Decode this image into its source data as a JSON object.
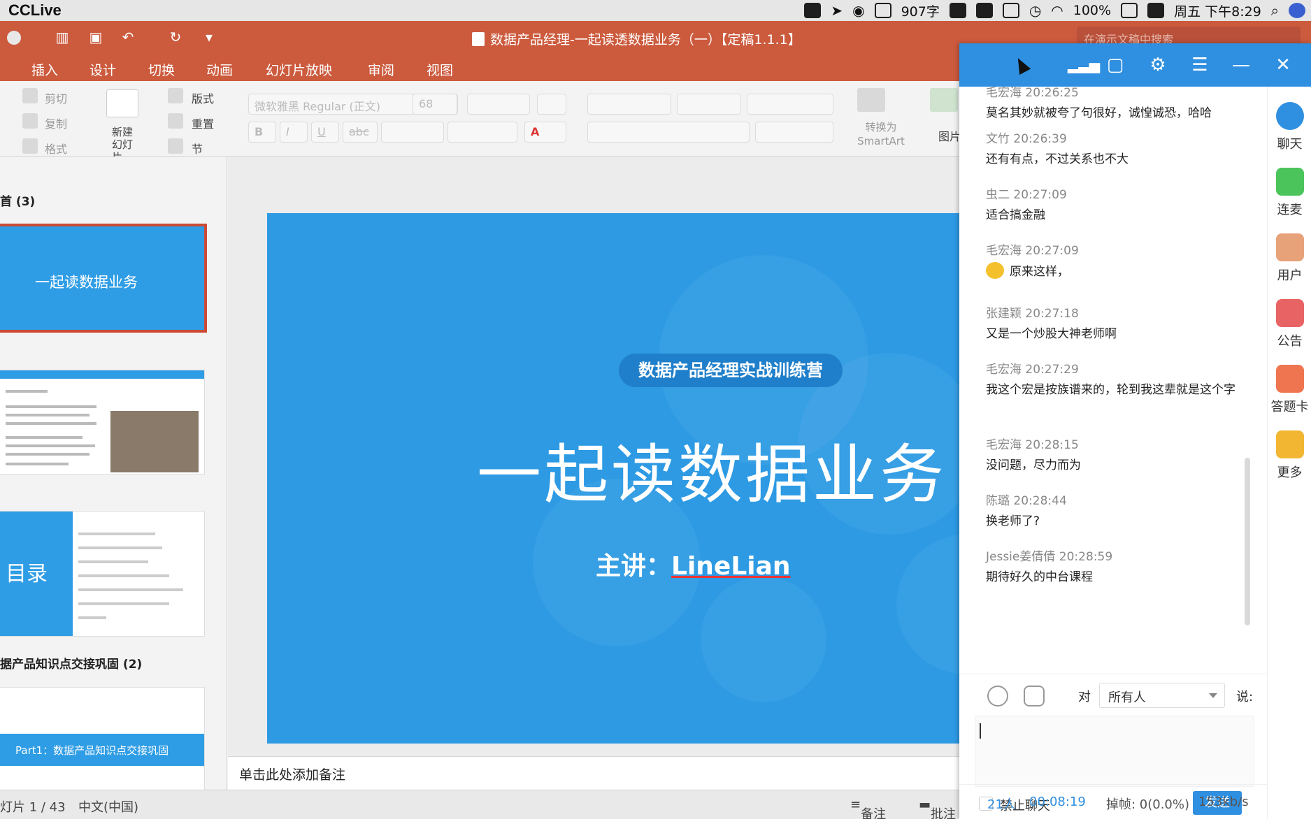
{
  "menubar": {
    "app_name": "CCLive",
    "word_count": "907字",
    "battery": "100%",
    "datetime": "周五 下午8:29"
  },
  "window": {
    "title": "数据产品经理-一起读透数据业务（一）【定稿1.1.1】",
    "search_placeholder": "在演示文稿中搜索"
  },
  "ribbon_tabs": [
    "插入",
    "设计",
    "切换",
    "动画",
    "幻灯片放映",
    "审阅",
    "视图"
  ],
  "ribbon": {
    "cut": "剪切",
    "copy": "复制",
    "format": "格式",
    "new_slide": "新建幻灯片",
    "layout": "版式",
    "reset": "重置",
    "section": "节",
    "font_name": "微软雅黑 Regular (正文)",
    "font_size": "68",
    "bold": "B",
    "italic": "I",
    "underline": "U",
    "strike": "abc",
    "convert_smartart": "转换为SmartArt",
    "picture": "图片"
  },
  "thumbnails": {
    "section1_label": "首 (3)",
    "slide1_title": "一起读数据业务",
    "slide3_title": "目录",
    "section2_label": "据产品知识点交接巩固 (2)",
    "slide4_band": "Part1：数据产品知识点交接巩固"
  },
  "slide": {
    "subtitle": "数据产品经理实战训练营",
    "title": "一起读数据业务",
    "speaker_prefix": "主讲：",
    "speaker_name": "LineLian"
  },
  "notes_placeholder": "单击此处添加备注",
  "statusbar": {
    "slide_position": "灯片 1 / 43",
    "language": "中文(中国)",
    "notes": "备注",
    "comments": "批注"
  },
  "chat": {
    "messages": [
      {
        "user": "毛宏海",
        "time": "20:26:25",
        "text": "莫名其妙就被夸了句很好，诚惶诚恐，哈哈"
      },
      {
        "user": "文竹",
        "time": "20:26:39",
        "text": "还有有点，不过关系也不大"
      },
      {
        "user": "虫二",
        "time": "20:27:09",
        "text": "适合搞金融"
      },
      {
        "user": "毛宏海",
        "time": "20:27:09",
        "text": "原来这样，"
      },
      {
        "user": "张建颖",
        "time": "20:27:18",
        "text": "又是一个炒股大神老师啊"
      },
      {
        "user": "毛宏海",
        "time": "20:27:29",
        "text": "我这个宏是按族谱来的，轮到我这辈就是这个字"
      },
      {
        "user": "毛宏海",
        "time": "20:28:15",
        "text": "没问题，尽力而为"
      },
      {
        "user": "陈璐",
        "time": "20:28:44",
        "text": "换老师了?"
      },
      {
        "user": "Jessie姜倩倩",
        "time": "20:28:59",
        "text": "期待好久的中台课程"
      }
    ],
    "sidebar": [
      "聊天",
      "连麦",
      "用户",
      "公告",
      "答题卡",
      "更多"
    ],
    "to_label": "对",
    "recipient": "所有人",
    "say_label": "说:",
    "mute_label": "禁止聊天",
    "send_label": "发送",
    "online_count": "21人",
    "elapsed": "00:08:19",
    "drop_rate": "掉帧: 0(0.0%)",
    "bitrate": "153kb/s"
  },
  "colors": {
    "ppt_accent": "#cc5a3d",
    "slide_blue": "#2d9ae3",
    "chat_blue": "#2f8fe0"
  }
}
